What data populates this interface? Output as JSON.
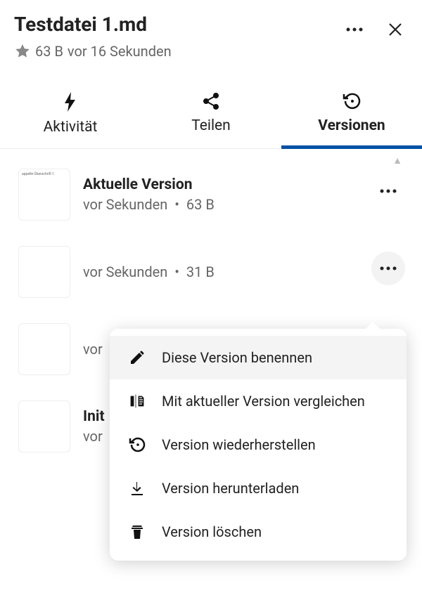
{
  "header": {
    "title": "Testdatei 1.md",
    "size": "63 B",
    "time_ago": "vor 16 Sekunden"
  },
  "tabs": {
    "activity": "Aktivität",
    "share": "Teilen",
    "versions": "Versionen"
  },
  "versions": [
    {
      "title": "Aktuelle Version",
      "time": "vor Sekunden",
      "size": "63 B",
      "thumb_text": "appelle Überschrift 1."
    },
    {
      "title": "",
      "time": "vor Sekunden",
      "size": "31 B",
      "thumb_text": ""
    },
    {
      "title": "",
      "time": "vor",
      "size": "",
      "thumb_text": ""
    },
    {
      "title": "Init",
      "time": "vor",
      "size": "",
      "thumb_text": ""
    }
  ],
  "menu": {
    "rename": "Diese Version benennen",
    "compare": "Mit aktueller Version vergleichen",
    "restore": "Version wiederherstellen",
    "download": "Version herunterladen",
    "delete": "Version löschen"
  }
}
